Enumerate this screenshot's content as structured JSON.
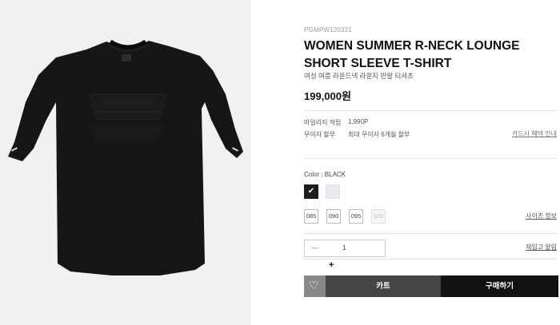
{
  "product": {
    "code": "PGMPW120321",
    "title": "WOMEN SUMMER R-NECK LOUNGE SHORT SLEEVE T-SHIRT",
    "subtitle": "여성 여름 라운드넥 라운지 반팔 티셔츠",
    "price": "199,000원",
    "image_icon": "black-tshirt-image",
    "mileage_label": "마일리지 적립",
    "mileage_value": "1,990P",
    "installment_label": "무이자 할부",
    "installment_value": "최대 무이자 6개월 할부",
    "card_benefit_link": "카드사 혜택 안내"
  },
  "options": {
    "color_label": "Color : BLACK",
    "colors": [
      {
        "name": "black",
        "hex": "#1e1e1e",
        "selected": true,
        "check": "✔"
      },
      {
        "name": "white",
        "hex": "#e8eaf0",
        "selected": false
      }
    ],
    "sizes": [
      "085",
      "090",
      "095",
      "100"
    ],
    "size_guide_link": "사이즈 정보",
    "quantity": "1",
    "minus": "—",
    "plus": "+",
    "restock_link": "재입고 알림"
  },
  "actions": {
    "wish_icon": "heart-icon",
    "wish_symbol": "♡",
    "cart_label": "카트",
    "buy_label": "구매하기"
  }
}
